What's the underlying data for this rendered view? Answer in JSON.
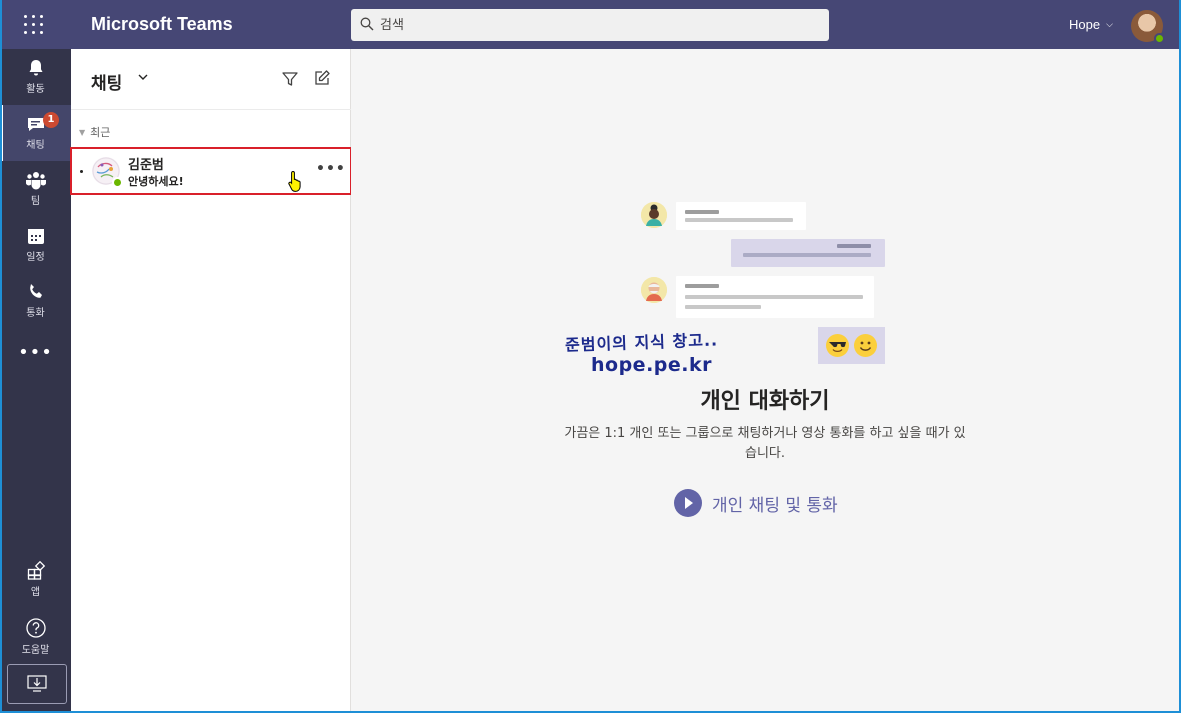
{
  "topbar": {
    "app_title": "Microsoft Teams",
    "search_placeholder": "검색",
    "user_name": "Hope",
    "accent_color": "#464775"
  },
  "rail": {
    "items": [
      {
        "label": "활동",
        "icon": "bell-icon"
      },
      {
        "label": "채팅",
        "icon": "chat-icon",
        "badge": "1",
        "active": true
      },
      {
        "label": "팀",
        "icon": "teams-icon"
      },
      {
        "label": "일정",
        "icon": "calendar-icon"
      },
      {
        "label": "통화",
        "icon": "phone-icon"
      }
    ],
    "more": "•••",
    "bottom": [
      {
        "label": "앱",
        "icon": "apps-icon"
      },
      {
        "label": "도움말",
        "icon": "help-icon"
      }
    ]
  },
  "chat_panel": {
    "title": "채팅",
    "section_label": "최근",
    "items": [
      {
        "name": "김준범",
        "preview": "안녕하세요!",
        "status": "available"
      }
    ],
    "more_label": "•••"
  },
  "main": {
    "watermark_line1": "준범이의 지식 창고..",
    "watermark_line2": "hope.pe.kr",
    "empty_title": "개인 대화하기",
    "empty_desc": "가끔은 1:1 개인 또는 그룹으로 채팅하거나 영상 통화를 하고 싶을 때가 있습니다.",
    "cta_label": "개인 채팅 및 통화"
  },
  "colors": {
    "brand": "#6264a7",
    "highlight_border": "#d9202a",
    "presence": "#6bb700",
    "badge": "#cc4a31"
  }
}
